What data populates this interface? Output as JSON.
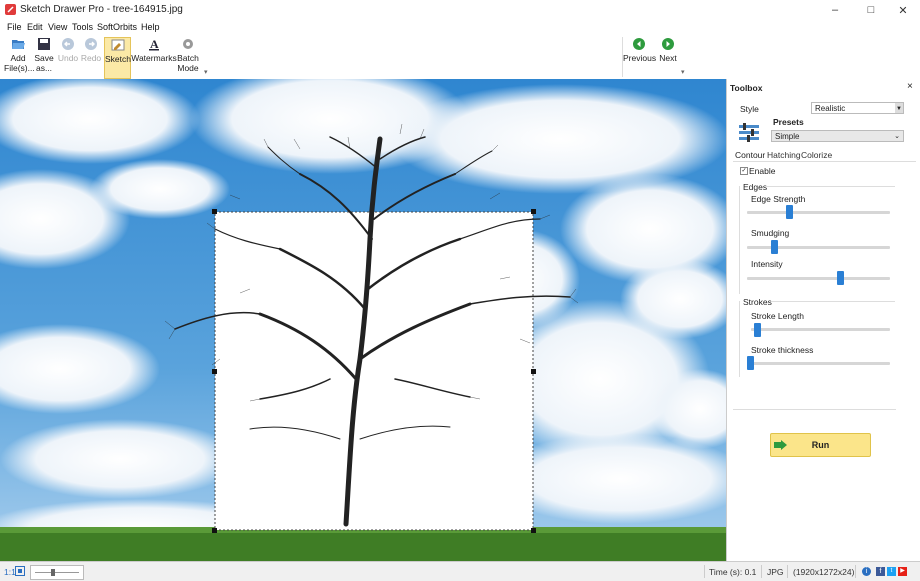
{
  "window": {
    "title": "Sketch Drawer Pro - tree-164915.jpg"
  },
  "menu": [
    "File",
    "Edit",
    "View",
    "Tools",
    "SoftOrbits",
    "Help"
  ],
  "toolbar": {
    "add_files": "Add File(s)...",
    "save_as": "Save as...",
    "undo": "Undo",
    "redo": "Redo",
    "sketch": "Sketch",
    "watermarks": "Watermarks",
    "batch_mode": "Batch Mode",
    "previous": "Previous",
    "next": "Next"
  },
  "toolbox": {
    "title": "Toolbox",
    "style_label": "Style",
    "style_value": "Realistic",
    "presets_label": "Presets",
    "presets_value": "Simple",
    "tabs": [
      "Contour",
      "Hatching",
      "Colorize"
    ],
    "enable_label": "Enable",
    "enable_checked": true,
    "edges_group": "Edges",
    "edge_strength_label": "Edge Strength",
    "edge_strength_value": 0.29,
    "smudging_label": "Smudging",
    "smudging_value": 0.18,
    "intensity_label": "Intensity",
    "intensity_value": 0.66,
    "strokes_group": "Strokes",
    "stroke_length_label": "Stroke Length",
    "stroke_length_value": 0.02,
    "stroke_thickness_label": "Stroke thickness",
    "stroke_thickness_value": 0.0,
    "run_label": "Run"
  },
  "statusbar": {
    "zoom_label": "1:1",
    "time": "Time (s): 0.1",
    "format": "JPG",
    "dimensions": "(1920x1272x24)"
  },
  "colors": {
    "accent": "#2a7fd4",
    "run_button": "#fbe58a",
    "sky": "#3b8fd3"
  }
}
